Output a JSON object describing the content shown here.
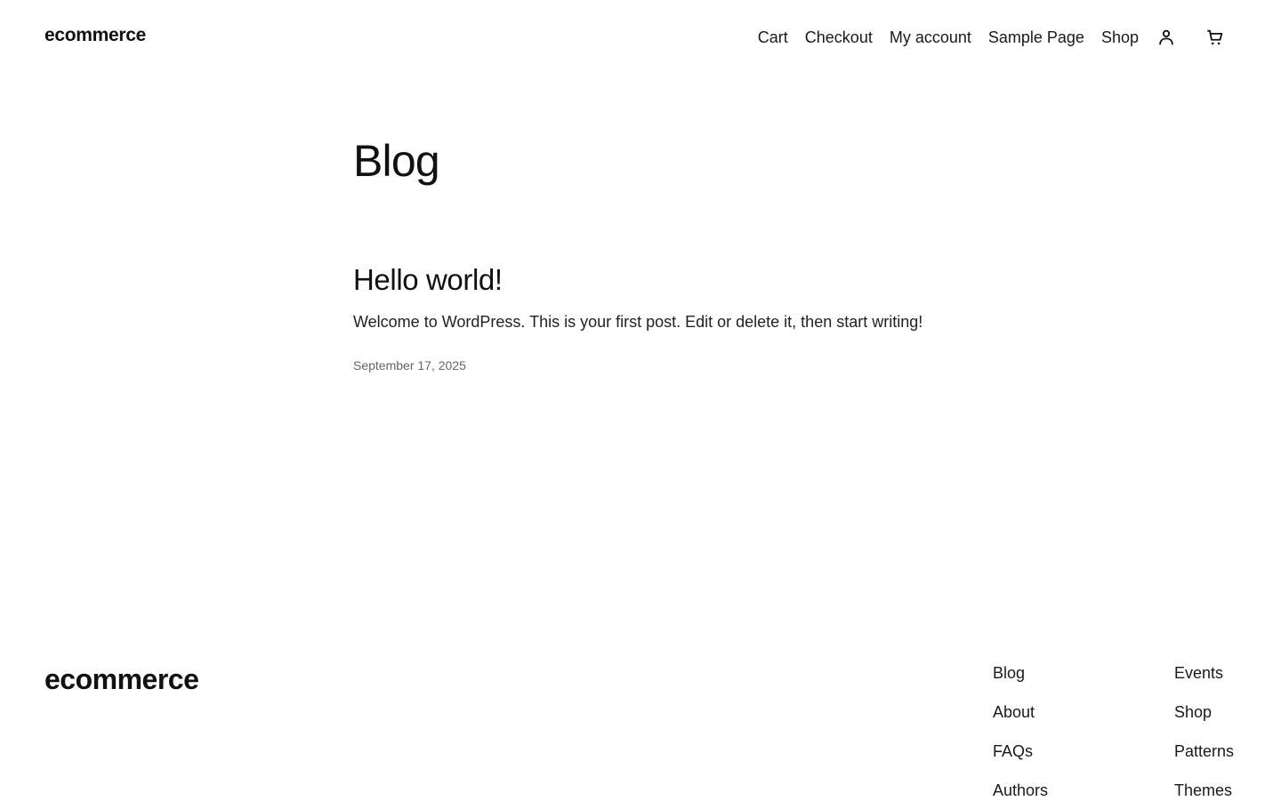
{
  "header": {
    "site_title": "ecommerce",
    "nav": [
      "Cart",
      "Checkout",
      "My account",
      "Sample Page",
      "Shop"
    ],
    "icons": [
      "account-icon",
      "cart-icon"
    ]
  },
  "main": {
    "page_title": "Blog",
    "posts": [
      {
        "title": "Hello world!",
        "excerpt": "Welcome to WordPress. This is your first post. Edit or delete it, then start writing!",
        "date": "September 17, 2025"
      }
    ]
  },
  "footer": {
    "site_title": "ecommerce",
    "columns": [
      [
        "Blog",
        "About",
        "FAQs",
        "Authors"
      ],
      [
        "Events",
        "Shop",
        "Patterns",
        "Themes"
      ]
    ]
  }
}
